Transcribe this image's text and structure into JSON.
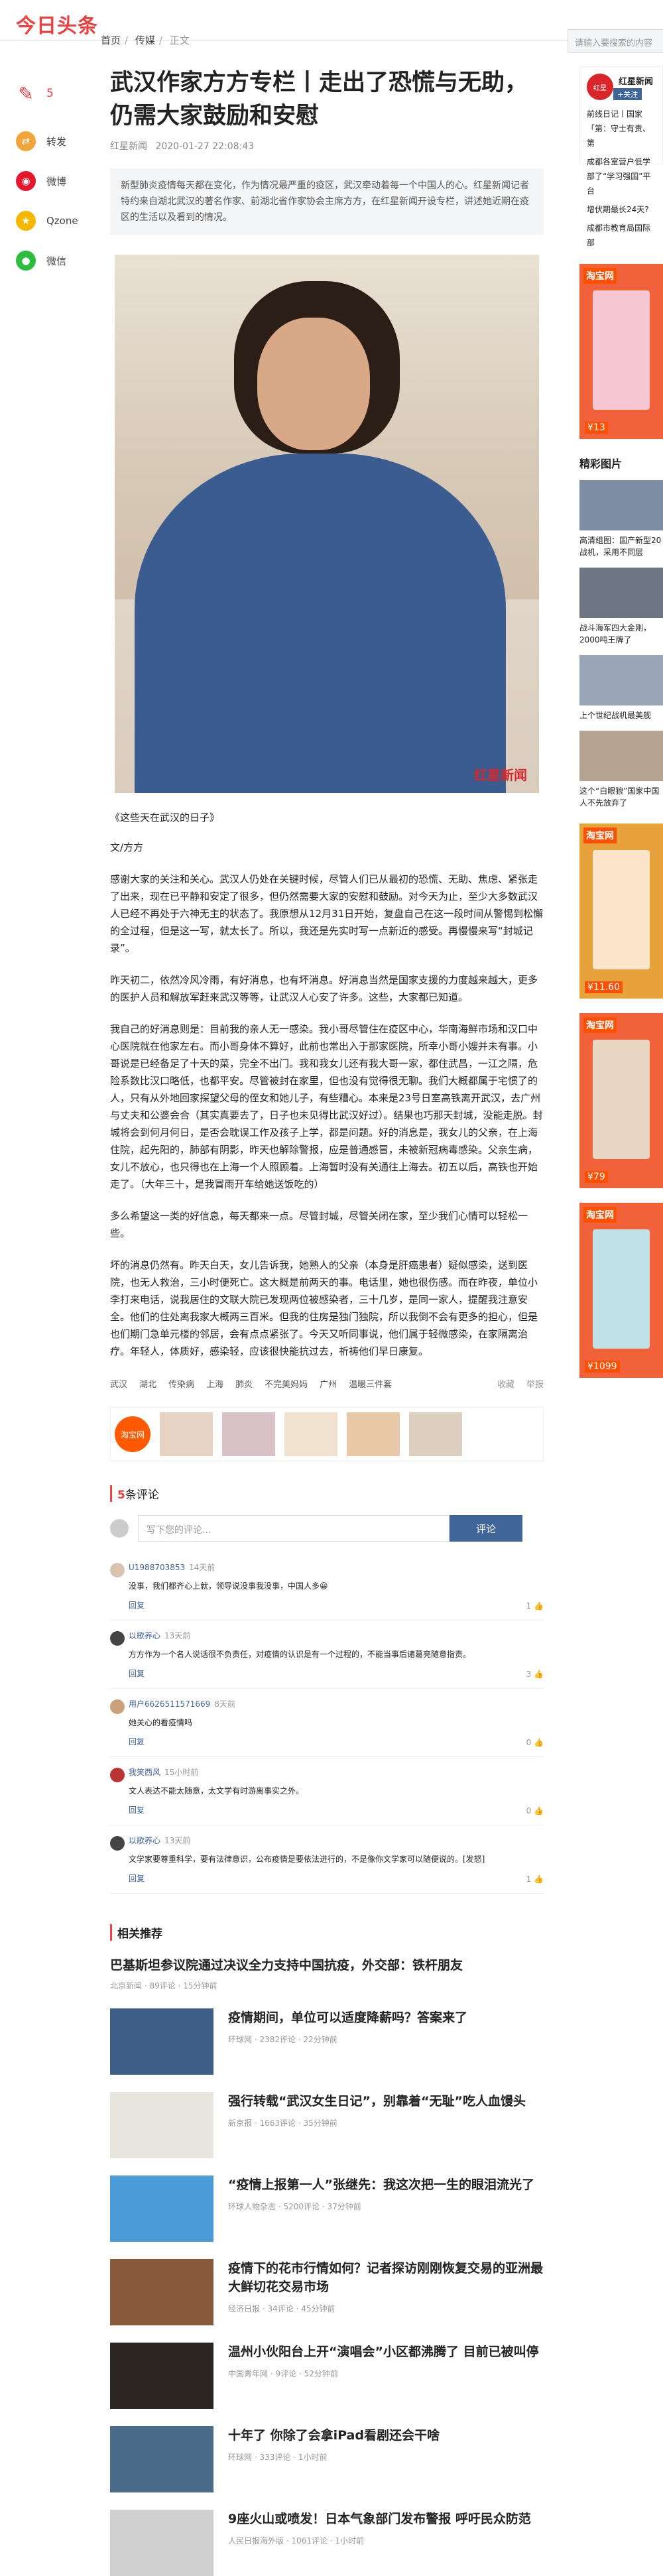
{
  "header": {
    "logo": "今日头条",
    "breadcrumb": [
      "首页",
      "传媒",
      "正文"
    ],
    "search_placeholder": "请输入要搜索的内容"
  },
  "leftbar": {
    "comment_count": "5",
    "items": [
      "转发",
      "微博",
      "Qzone",
      "微信"
    ]
  },
  "article": {
    "title": "武汉作家方方专栏丨走出了恐慌与无助，仍需大家鼓励和安慰",
    "source": "红星新闻",
    "time": "2020-01-27 22:08:43",
    "summary": "新型肺炎疫情每天都在变化，作为情况最严重的疫区，武汉牵动着每一个中国人的心。红星新闻记者特约来自湖北武汉的著名作家、前湖北省作家协会主席方方，在红星新闻开设专栏，讲述她近期在疫区的生活以及看到的情况。",
    "photo_watermark": "红星新闻",
    "caption": "《这些天在武汉的日子》",
    "byline": "文/方方",
    "paragraphs": [
      "感谢大家的关注和关心。武汉人仍处在关键时候，尽管人们已从最初的恐慌、无助、焦虑、紧张走了出来，现在已平静和安定了很多，但仍然需要大家的安慰和鼓励。对今天为止，至少大多数武汉人已经不再处于六神无主的状态了。我原想从12月31日开始，复盘自己在这一段时间从警惕到松懈的全过程，但是这一写，就太长了。所以，我还是先实时写一点新近的感受。再慢慢来写“封城记录”。",
      "昨天初二，依然冷风冷雨，有好消息，也有坏消息。好消息当然是国家支援的力度越来越大，更多的医护人员和解放军赶来武汉等等，让武汉人心安了许多。这些，大家都已知道。",
      "我自己的好消息则是：目前我的亲人无一感染。我小哥尽管住在疫区中心，华南海鲜市场和汉口中心医院就在他家左右。而小哥身体不算好，此前也常出入于那家医院，所幸小哥小嫂并未有事。小哥说是已经备足了十天的菜，完全不出门。我和我女儿还有我大哥一家，都住武昌，一江之隔，危险系数比汉口略低，也都平安。尽管被封在家里，但也没有觉得很无聊。我们大概都属于宅惯了的人，只有从外地回家探望父母的侄女和她儿子，有些糟心。本来是23号日室高铁离开武汉，去广州与丈夫和公婆会合（其实真要去了，日子也未见得比武汉好过）。结果也巧那天封城，没能走脱。封城将会到何月何日，是否会耽误工作及孩子上学，都是问题。好的消息是，我女儿的父亲，在上海住院，起先阳的，肺部有阴影，昨天也解除警报，应是普通感冒，未被新冠病毒感染。父亲生病，女儿不放心，也只得也在上海一个人照顾着。上海暂时没有关通往上海去。初五以后，高铁也开始走了。（大年三十，是我冒雨开车给她送饭吃的）",
      "多么希望这一类的好信息，每天都来一点。尽管封城，尽管关闭在家，至少我们心情可以轻松一些。",
      "坏的消息仍然有。昨天白天，女儿告诉我，她熟人的父亲（本身是肝癌患者）疑似感染，送到医院，也无人救治，三小时便死亡。这大概是前两天的事。电话里，她也很伤感。而在昨夜，单位小李打来电话，说我居住的文联大院已发现两位被感染者，三十几岁，是同一家人，提醒我注意安全。他们的住处离我家大概两三百米。但我的住房是独门独院，所以我倒不会有更多的担心，但是也们期门急单元楼的邻居，会有点点紧张了。今天又听同事说，他们属于轻微感染，在家隔离治疗。年轻人，体质好，感染轻，应该很快能抗过去，祈祷他们早日康复。"
    ],
    "tags": [
      "武汉",
      "湖北",
      "传染病",
      "上海",
      "肺炎",
      "不完美妈妈",
      "广州",
      "温暖三件套"
    ],
    "favorite": "收藏",
    "report": "举报",
    "adstrip_label": "淘宝网"
  },
  "comments": {
    "title_count": "5",
    "title_text": "条评论",
    "input_placeholder": "写下您的评论...",
    "submit_label": "评论",
    "items": [
      {
        "user": "U1988703853",
        "time": "14天前",
        "text": "没事，我们都齐心上就，领导说没事我没事，中国人多😀",
        "reply": "回复",
        "likes": "1"
      },
      {
        "user": "以歌养心",
        "time": "13天前",
        "text": "方方作为一个名人说话很不负责任，对疫情的认识是有一个过程的，不能当事后诸葛亮随意指责。",
        "reply": "回复",
        "likes": "3"
      },
      {
        "user": "用户6626511571669",
        "time": "8天前",
        "text": "她关心的看疫情吗",
        "reply": "回复",
        "likes": "0"
      },
      {
        "user": "我笑西风",
        "time": "15小时前",
        "text": "文人表达不能太随意，太文学有时游离事实之外。",
        "reply": "回复",
        "likes": "0"
      },
      {
        "user": "以歌养心",
        "time": "13天前",
        "text": "文学家要尊重科学，要有法律意识，公布疫情是要依法进行的，不是像你文学家可以随便说的。[发怒]",
        "reply": "回复",
        "likes": "1"
      }
    ]
  },
  "related": {
    "title": "相关推荐",
    "top": {
      "title": "巴基斯坦参议院通过决议全力支持中国抗疫，外交部：铁杆朋友",
      "source": "北京新闻",
      "comments": "89评论",
      "time": "15分钟前"
    },
    "items": [
      {
        "title": "疫情期间，单位可以适度降薪吗？答案来了",
        "source": "环球网",
        "comments": "2382评论",
        "time": "22分钟前"
      },
      {
        "title": "强行转载“武汉女生日记”，别靠着“无耻”吃人血馒头",
        "source": "新京报",
        "comments": "1663评论",
        "time": "35分钟前"
      },
      {
        "title": "“疫情上报第一人”张继先：我这次把一生的眼泪流光了",
        "source": "环球人物杂志",
        "comments": "5200评论",
        "time": "37分钟前"
      },
      {
        "title": "疫情下的花市行情如何？记者探访刚刚恢复交易的亚洲最大鲜切花交易市场",
        "source": "经济日报",
        "comments": "34评论",
        "time": "45分钟前"
      },
      {
        "title": "温州小伙阳台上开“演唱会”小区都沸腾了 目前已被叫停",
        "source": "中国青年网",
        "comments": "9评论",
        "time": "52分钟前"
      },
      {
        "title": "十年了 你除了会拿iPad看剧还会干啥",
        "source": "环球网",
        "comments": "333评论",
        "time": "1小时前"
      },
      {
        "title": "9座火山或喷发！日本气象部门发布警报 呼吁民众防范",
        "source": "人民日报海外版",
        "comments": "1061评论",
        "time": "1小时前"
      }
    ]
  },
  "right": {
    "account_name": "红星新闻",
    "follow": "+关注",
    "account_items": [
      "前线日记丨国家「第：守士有责、第",
      "成都各室营户低学部了“学习强国”平台",
      "增伏期最长24天?",
      "成都市教育局国际部"
    ],
    "ad_label": "淘宝网",
    "ad_prices": [
      "¥13",
      "¥11.60",
      "¥79",
      "¥1099"
    ],
    "section_title": "精彩图片",
    "pics": [
      "高清组图：国产新型20战机，采用不同层",
      "战斗海军四大金刚，2000吨王牌了",
      "上个世纪战机最美舰",
      "这个“白眼狼”国家中国人不先放弃了"
    ]
  }
}
